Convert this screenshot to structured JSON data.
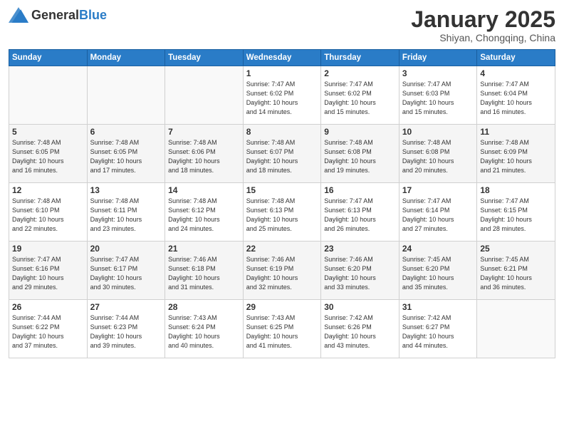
{
  "header": {
    "logo_general": "General",
    "logo_blue": "Blue",
    "month_title": "January 2025",
    "subtitle": "Shiyan, Chongqing, China"
  },
  "weekdays": [
    "Sunday",
    "Monday",
    "Tuesday",
    "Wednesday",
    "Thursday",
    "Friday",
    "Saturday"
  ],
  "weeks": [
    [
      {
        "day": "",
        "info": ""
      },
      {
        "day": "",
        "info": ""
      },
      {
        "day": "",
        "info": ""
      },
      {
        "day": "1",
        "info": "Sunrise: 7:47 AM\nSunset: 6:02 PM\nDaylight: 10 hours\nand 14 minutes."
      },
      {
        "day": "2",
        "info": "Sunrise: 7:47 AM\nSunset: 6:02 PM\nDaylight: 10 hours\nand 15 minutes."
      },
      {
        "day": "3",
        "info": "Sunrise: 7:47 AM\nSunset: 6:03 PM\nDaylight: 10 hours\nand 15 minutes."
      },
      {
        "day": "4",
        "info": "Sunrise: 7:47 AM\nSunset: 6:04 PM\nDaylight: 10 hours\nand 16 minutes."
      }
    ],
    [
      {
        "day": "5",
        "info": "Sunrise: 7:48 AM\nSunset: 6:05 PM\nDaylight: 10 hours\nand 16 minutes."
      },
      {
        "day": "6",
        "info": "Sunrise: 7:48 AM\nSunset: 6:05 PM\nDaylight: 10 hours\nand 17 minutes."
      },
      {
        "day": "7",
        "info": "Sunrise: 7:48 AM\nSunset: 6:06 PM\nDaylight: 10 hours\nand 18 minutes."
      },
      {
        "day": "8",
        "info": "Sunrise: 7:48 AM\nSunset: 6:07 PM\nDaylight: 10 hours\nand 18 minutes."
      },
      {
        "day": "9",
        "info": "Sunrise: 7:48 AM\nSunset: 6:08 PM\nDaylight: 10 hours\nand 19 minutes."
      },
      {
        "day": "10",
        "info": "Sunrise: 7:48 AM\nSunset: 6:08 PM\nDaylight: 10 hours\nand 20 minutes."
      },
      {
        "day": "11",
        "info": "Sunrise: 7:48 AM\nSunset: 6:09 PM\nDaylight: 10 hours\nand 21 minutes."
      }
    ],
    [
      {
        "day": "12",
        "info": "Sunrise: 7:48 AM\nSunset: 6:10 PM\nDaylight: 10 hours\nand 22 minutes."
      },
      {
        "day": "13",
        "info": "Sunrise: 7:48 AM\nSunset: 6:11 PM\nDaylight: 10 hours\nand 23 minutes."
      },
      {
        "day": "14",
        "info": "Sunrise: 7:48 AM\nSunset: 6:12 PM\nDaylight: 10 hours\nand 24 minutes."
      },
      {
        "day": "15",
        "info": "Sunrise: 7:48 AM\nSunset: 6:13 PM\nDaylight: 10 hours\nand 25 minutes."
      },
      {
        "day": "16",
        "info": "Sunrise: 7:47 AM\nSunset: 6:13 PM\nDaylight: 10 hours\nand 26 minutes."
      },
      {
        "day": "17",
        "info": "Sunrise: 7:47 AM\nSunset: 6:14 PM\nDaylight: 10 hours\nand 27 minutes."
      },
      {
        "day": "18",
        "info": "Sunrise: 7:47 AM\nSunset: 6:15 PM\nDaylight: 10 hours\nand 28 minutes."
      }
    ],
    [
      {
        "day": "19",
        "info": "Sunrise: 7:47 AM\nSunset: 6:16 PM\nDaylight: 10 hours\nand 29 minutes."
      },
      {
        "day": "20",
        "info": "Sunrise: 7:47 AM\nSunset: 6:17 PM\nDaylight: 10 hours\nand 30 minutes."
      },
      {
        "day": "21",
        "info": "Sunrise: 7:46 AM\nSunset: 6:18 PM\nDaylight: 10 hours\nand 31 minutes."
      },
      {
        "day": "22",
        "info": "Sunrise: 7:46 AM\nSunset: 6:19 PM\nDaylight: 10 hours\nand 32 minutes."
      },
      {
        "day": "23",
        "info": "Sunrise: 7:46 AM\nSunset: 6:20 PM\nDaylight: 10 hours\nand 33 minutes."
      },
      {
        "day": "24",
        "info": "Sunrise: 7:45 AM\nSunset: 6:20 PM\nDaylight: 10 hours\nand 35 minutes."
      },
      {
        "day": "25",
        "info": "Sunrise: 7:45 AM\nSunset: 6:21 PM\nDaylight: 10 hours\nand 36 minutes."
      }
    ],
    [
      {
        "day": "26",
        "info": "Sunrise: 7:44 AM\nSunset: 6:22 PM\nDaylight: 10 hours\nand 37 minutes."
      },
      {
        "day": "27",
        "info": "Sunrise: 7:44 AM\nSunset: 6:23 PM\nDaylight: 10 hours\nand 39 minutes."
      },
      {
        "day": "28",
        "info": "Sunrise: 7:43 AM\nSunset: 6:24 PM\nDaylight: 10 hours\nand 40 minutes."
      },
      {
        "day": "29",
        "info": "Sunrise: 7:43 AM\nSunset: 6:25 PM\nDaylight: 10 hours\nand 41 minutes."
      },
      {
        "day": "30",
        "info": "Sunrise: 7:42 AM\nSunset: 6:26 PM\nDaylight: 10 hours\nand 43 minutes."
      },
      {
        "day": "31",
        "info": "Sunrise: 7:42 AM\nSunset: 6:27 PM\nDaylight: 10 hours\nand 44 minutes."
      },
      {
        "day": "",
        "info": ""
      }
    ]
  ]
}
